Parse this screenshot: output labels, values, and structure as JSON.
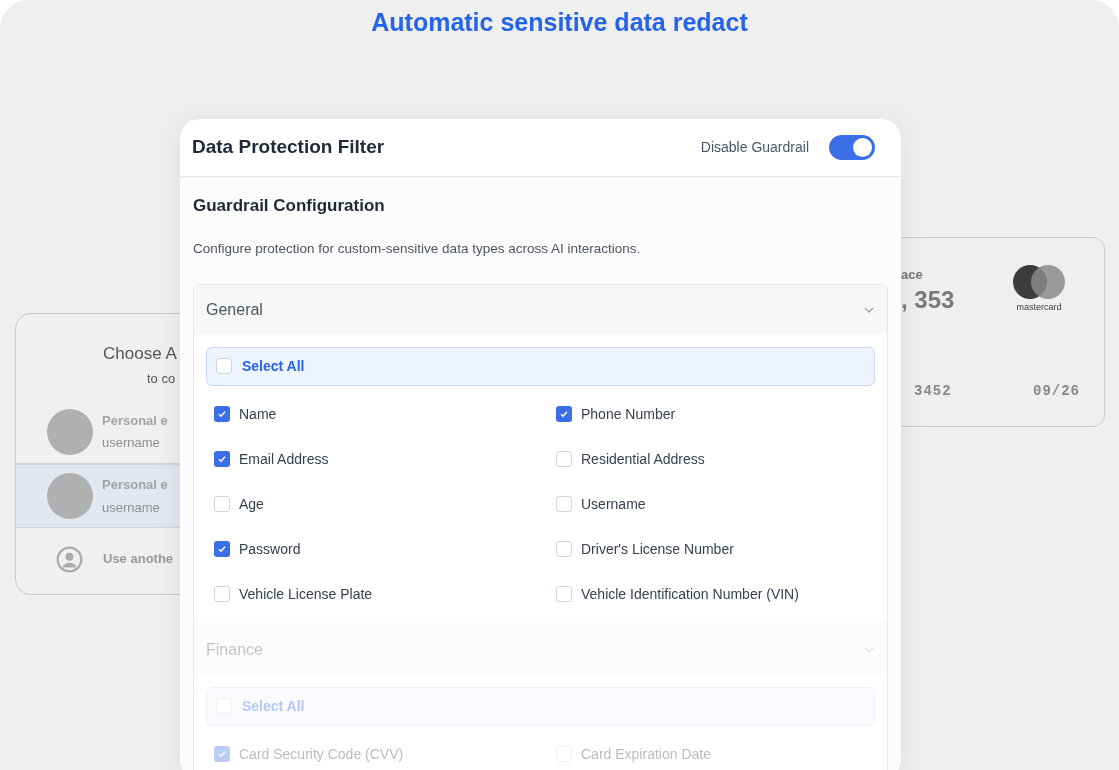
{
  "headline": "Automatic sensitive data redact",
  "account_card": {
    "title": "Choose A",
    "subtitle": "to co",
    "accounts": [
      {
        "name": "Personal e",
        "email": "username",
        "selected": false
      },
      {
        "name": "Personal e",
        "email": "username",
        "selected": true
      }
    ],
    "other_option": "Use anothe"
  },
  "bank_card": {
    "balance_label": "ace",
    "balance": ", 353",
    "brand": "mastercard",
    "number": "3452",
    "expiry": "09/26"
  },
  "dialog": {
    "title": "Data Protection Filter",
    "toggle": {
      "label": "Disable Guardrail",
      "on": true
    },
    "heading": "Guardrail Configuration",
    "description": "Configure protection for custom-sensitive data types across AI interactions.",
    "sections": [
      {
        "name": "General",
        "dimmed": false,
        "select_all": {
          "label": "Select All",
          "checked": false
        },
        "items": [
          {
            "label": "Name",
            "checked": true
          },
          {
            "label": "Phone Number",
            "checked": true
          },
          {
            "label": "Email Address",
            "checked": true
          },
          {
            "label": "Residential Address",
            "checked": false
          },
          {
            "label": "Age",
            "checked": false
          },
          {
            "label": "Username",
            "checked": false
          },
          {
            "label": "Password",
            "checked": true
          },
          {
            "label": "Driver's License Number",
            "checked": false
          },
          {
            "label": "Vehicle License Plate",
            "checked": false
          },
          {
            "label": "Vehicle Identification Number (VIN)",
            "checked": false
          }
        ]
      },
      {
        "name": "Finance",
        "dimmed": true,
        "select_all": {
          "label": "Select All",
          "checked": false
        },
        "items": [
          {
            "label": "Card Security Code (CVV)",
            "checked": true
          },
          {
            "label": "Card Expiration Date",
            "checked": false
          }
        ]
      }
    ]
  }
}
